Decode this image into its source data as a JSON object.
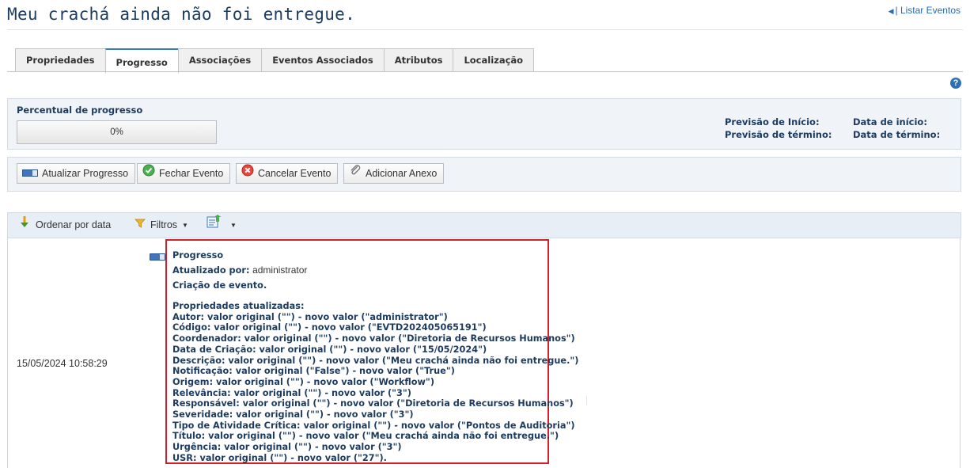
{
  "page_title": "Meu crachá ainda não foi entregue.",
  "top_link": "| Listar Eventos",
  "tabs": [
    "Propriedades",
    "Progresso",
    "Associações",
    "Eventos Associados",
    "Atributos",
    "Localização"
  ],
  "active_tab": "Progresso",
  "progress": {
    "label": "Percentual de progresso",
    "value_text": "0%",
    "value": 0,
    "previsao_inicio": "Previsão de Início:",
    "previsao_termino": "Previsão de término:",
    "data_inicio": "Data de início:",
    "data_termino": "Data de término:"
  },
  "actions": {
    "atualizar": "Atualizar Progresso",
    "fechar": "Fechar Evento",
    "cancelar": "Cancelar Evento",
    "anexo": "Adicionar Anexo"
  },
  "toolbar": {
    "ordenar": "Ordenar por data",
    "filtros": "Filtros"
  },
  "history": {
    "timestamp": "15/05/2024 10:58:29",
    "title": "Progresso",
    "updated_by_label": "Atualizado por:",
    "updated_by": "administrator",
    "action": "Criação de evento.",
    "props_header": "Propriedades atualizadas:",
    "changes": [
      "Autor: valor original (\"\") - novo valor (\"administrator\")",
      "Código: valor original (\"\") - novo valor (\"EVTD202405065191\")",
      "Coordenador: valor original (\"\") - novo valor (\"Diretoria de Recursos Humanos\")",
      "Data de Criação: valor original (\"\") - novo valor (\"15/05/2024\")",
      "Descrição: valor original (\"\") - novo valor (\"Meu crachá ainda não foi entregue.\")",
      "Notificação: valor original (\"False\") - novo valor (\"True\")",
      "Origem: valor original (\"\") - novo valor (\"Workflow\")",
      "Relevância: valor original (\"\") - novo valor (\"3\")",
      "Responsável: valor original (\"\") - novo valor (\"Diretoria de Recursos Humanos\")",
      "Severidade: valor original (\"\") - novo valor (\"3\")",
      "Tipo de Atividade Crítica: valor original (\"\") - novo valor (\"Pontos de Auditoria\")",
      "Título: valor original (\"\") - novo valor (\"Meu crachá ainda não foi entregue.\")",
      "Urgência: valor original (\"\") - novo valor (\"3\")",
      "USR: valor original (\"\") - novo valor (\"27\")."
    ]
  }
}
